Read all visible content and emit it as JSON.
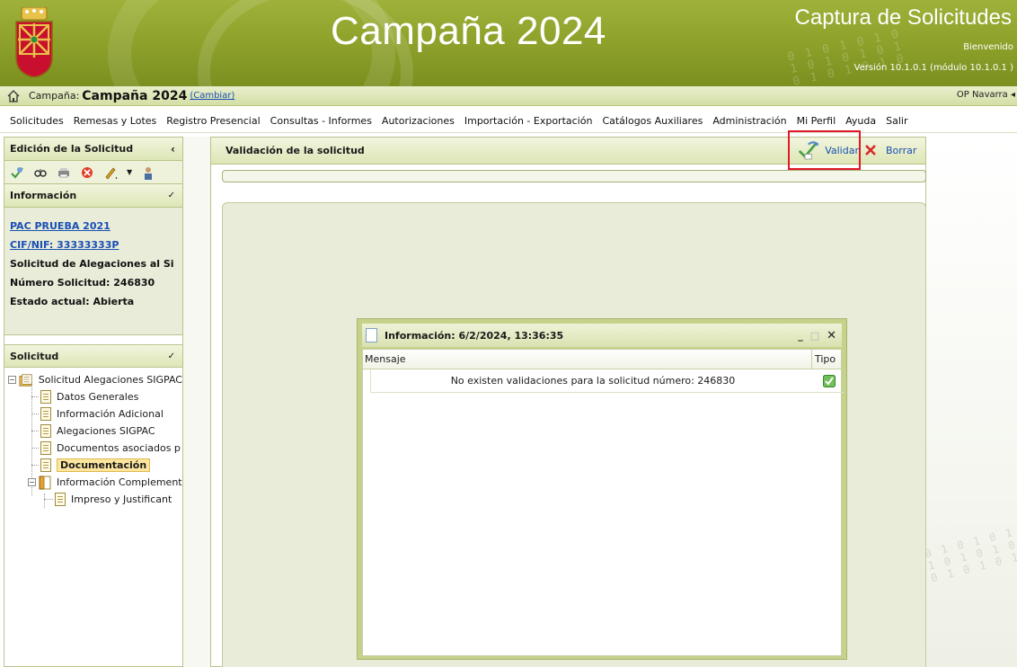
{
  "header": {
    "banner_title": "Campaña 2024",
    "app_title": "Captura de Solicitudes",
    "welcome": "Bienvenido",
    "version": "Versión 10.1.0.1 (módulo 10.1.0.1 )",
    "binary_decor": "0 1 0 1 0 1 0\n1 0 1 0 1 0 1\n0 1 0 1 0 1 0",
    "brand_color": "#8fa32c"
  },
  "campaign_bar": {
    "label": "Campaña:",
    "value": "Campaña 2024",
    "change_link": "(Cambiar)",
    "user": "OP Navarra"
  },
  "menu": {
    "items": [
      "Solicitudes",
      "Remesas y Lotes",
      "Registro Presencial",
      "Consultas - Informes",
      "Autorizaciones",
      "Importación - Exportación",
      "Catálogos Auxiliares",
      "Administración",
      "Mi Perfil",
      "Ayuda",
      "Salir"
    ]
  },
  "left": {
    "edition_title": "Edición de la Solicitud",
    "info_title": "Información",
    "info": {
      "name": "PAC PRUEBA 2021",
      "cif": "CIF/NIF: 33333333P",
      "solicitud": "Solicitud de Alegaciones al Si",
      "numero": "Número Solicitud: 246830",
      "estado": "Estado actual: Abierta"
    },
    "solicitud_title": "Solicitud",
    "tree": {
      "root": "Solicitud Alegaciones SIGPAC",
      "children": [
        "Datos Generales",
        "Información Adicional",
        "Alegaciones SIGPAC",
        "Documentos asociados p",
        "Documentación"
      ],
      "complement": "Información Complement",
      "complement_child": "Impreso y Justificant"
    }
  },
  "main": {
    "title": "Validación de la solicitud",
    "validar_label": "Validar",
    "borrar_label": "Borrar",
    "progress": 0
  },
  "dialog": {
    "title": "Información: 6/2/2024, 13:36:35",
    "col_mensaje": "Mensaje",
    "col_tipo": "Tipo",
    "rows": [
      {
        "mensaje": "No existen validaciones para la solicitud número: 246830",
        "tipo": "ok-icon"
      }
    ]
  }
}
